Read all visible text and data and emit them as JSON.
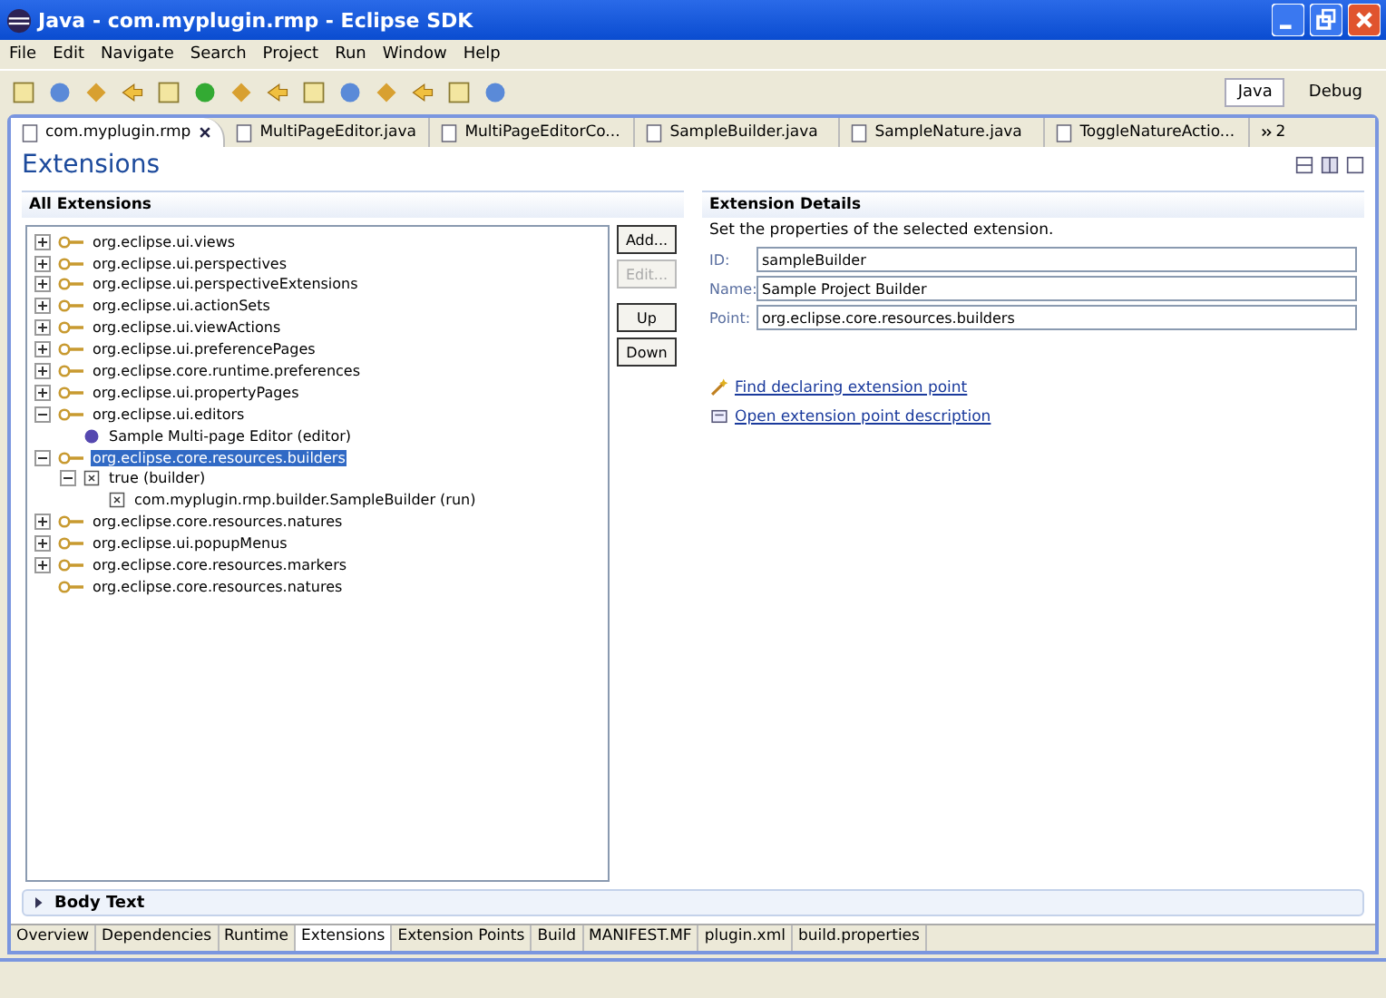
{
  "window": {
    "title": "Java - com.myplugin.rmp - Eclipse SDK"
  },
  "menu": [
    "File",
    "Edit",
    "Navigate",
    "Search",
    "Project",
    "Run",
    "Window",
    "Help"
  ],
  "perspectives": [
    {
      "label": "Java",
      "selected": true
    },
    {
      "label": "Debug",
      "selected": false
    }
  ],
  "editor_tabs": [
    {
      "label": "com.myplugin.rmp",
      "selected": true
    },
    {
      "label": "MultiPageEditor.java",
      "selected": false
    },
    {
      "label": "MultiPageEditorCo...",
      "selected": false
    },
    {
      "label": "SampleBuilder.java",
      "selected": false
    },
    {
      "label": "SampleNature.java",
      "selected": false
    },
    {
      "label": "ToggleNatureActio...",
      "selected": false
    }
  ],
  "more_tabs": "2",
  "page_title": "Extensions",
  "all_extensions": {
    "title": "All Extensions",
    "tree": [
      {
        "label": "org.eclipse.ui.views",
        "kind": "extension",
        "expanded": false,
        "selected": false
      },
      {
        "label": "org.eclipse.ui.perspectives",
        "kind": "extension",
        "expanded": false,
        "selected": false
      },
      {
        "label": "org.eclipse.ui.perspectiveExtensions",
        "kind": "extension",
        "expanded": false,
        "selected": false
      },
      {
        "label": "org.eclipse.ui.actionSets",
        "kind": "extension",
        "expanded": false,
        "selected": false
      },
      {
        "label": "org.eclipse.ui.viewActions",
        "kind": "extension",
        "expanded": false,
        "selected": false
      },
      {
        "label": "org.eclipse.ui.preferencePages",
        "kind": "extension",
        "expanded": false,
        "selected": false
      },
      {
        "label": "org.eclipse.core.runtime.preferences",
        "kind": "extension",
        "expanded": false,
        "selected": false
      },
      {
        "label": "org.eclipse.ui.propertyPages",
        "kind": "extension",
        "expanded": false,
        "selected": false
      },
      {
        "label": "org.eclipse.ui.editors",
        "kind": "extension",
        "expanded": true,
        "selected": false,
        "children": [
          {
            "label": "Sample Multi-page Editor (editor)",
            "kind": "editor",
            "selected": false
          }
        ]
      },
      {
        "label": "org.eclipse.core.resources.builders",
        "kind": "extension",
        "expanded": true,
        "selected": true,
        "children": [
          {
            "label": "true (builder)",
            "kind": "element",
            "expanded": true,
            "selected": false,
            "children": [
              {
                "label": "com.myplugin.rmp.builder.SampleBuilder (run)",
                "kind": "element",
                "selected": false
              }
            ]
          }
        ]
      },
      {
        "label": "org.eclipse.core.resources.natures",
        "kind": "extension",
        "expanded": false,
        "selected": false
      },
      {
        "label": "org.eclipse.ui.popupMenus",
        "kind": "extension",
        "expanded": false,
        "selected": false
      },
      {
        "label": "org.eclipse.core.resources.markers",
        "kind": "extension",
        "expanded": false,
        "selected": false
      },
      {
        "label": "org.eclipse.core.resources.natures",
        "kind": "extension",
        "selected": false
      }
    ],
    "buttons": [
      {
        "label": "Add...",
        "disabled": false
      },
      {
        "label": "Edit...",
        "disabled": true
      },
      {
        "label": "Up",
        "disabled": false
      },
      {
        "label": "Down",
        "disabled": false
      }
    ]
  },
  "details": {
    "title": "Extension Details",
    "description": "Set the properties of the selected extension.",
    "fields": [
      {
        "label": "ID:",
        "value": "sampleBuilder"
      },
      {
        "label": "Name:",
        "value": "Sample Project Builder"
      },
      {
        "label": "Point:",
        "value": "org.eclipse.core.resources.builders"
      }
    ],
    "links": [
      {
        "label": "Find declaring extension point",
        "kind": "find"
      },
      {
        "label": "Open extension point description",
        "kind": "open"
      }
    ]
  },
  "body_text": {
    "title": "Body Text",
    "expanded": false
  },
  "page_tabs": [
    {
      "label": "Overview",
      "selected": false
    },
    {
      "label": "Dependencies",
      "selected": false
    },
    {
      "label": "Runtime",
      "selected": false
    },
    {
      "label": "Extensions",
      "selected": true
    },
    {
      "label": "Extension Points",
      "selected": false
    },
    {
      "label": "Build",
      "selected": false
    },
    {
      "label": "MANIFEST.MF",
      "selected": false
    },
    {
      "label": "plugin.xml",
      "selected": false
    },
    {
      "label": "build.properties",
      "selected": false
    }
  ]
}
